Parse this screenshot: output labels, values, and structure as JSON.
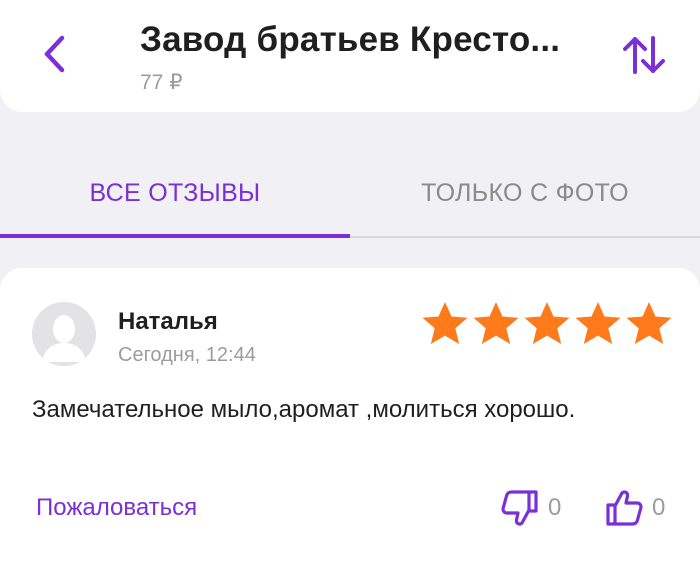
{
  "header": {
    "title": "Завод братьев Кресто...",
    "price": "77 ₽",
    "back_icon": "chevron-left-icon",
    "sort_icon": "sort-arrows-icon"
  },
  "tabs": [
    {
      "label": "ВСЕ ОТЗЫВЫ",
      "active": true
    },
    {
      "label": "ТОЛЬКО С ФОТО",
      "active": false
    }
  ],
  "review": {
    "author": "Наталья",
    "date": "Сегодня, 12:44",
    "rating": 5,
    "rating_max": 5,
    "text": "Замечательное мыло,аромат ,молиться хорошо.",
    "complain_label": "Пожаловаться",
    "dislikes": "0",
    "likes": "0"
  },
  "colors": {
    "accent": "#7b2fd6",
    "star": "#ff7a1a",
    "text": "#1f1f1f",
    "muted": "#9c9c9c",
    "background": "#f1f0f4"
  }
}
